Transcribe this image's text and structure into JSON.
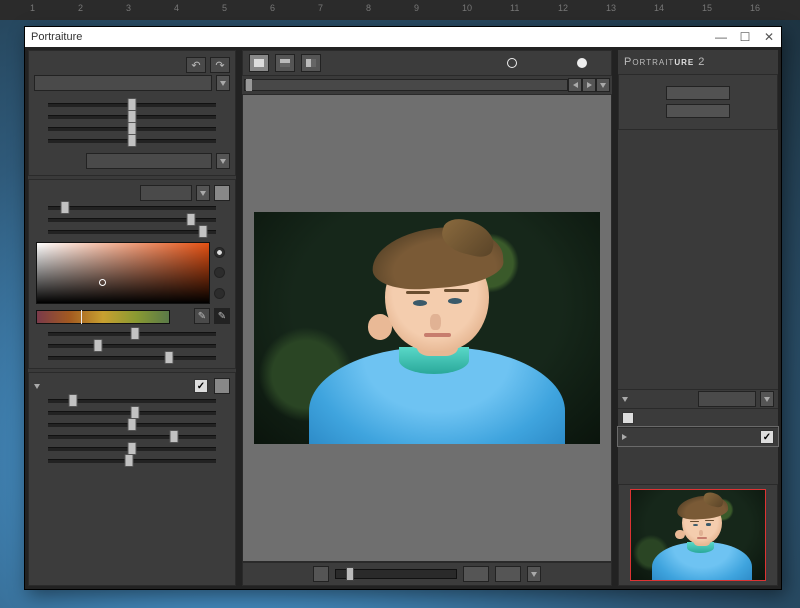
{
  "ruler_ticks": [
    "1",
    "2",
    "3",
    "4",
    "5",
    "6",
    "7",
    "8",
    "9",
    "10",
    "11",
    "12",
    "13",
    "14",
    "15",
    "16"
  ],
  "window": {
    "title": "Portraiture",
    "min": "—",
    "max": "☐",
    "close": "✕"
  },
  "left": {
    "history": {
      "undo": "↶",
      "redo": "↷"
    },
    "preset_sliders": [
      50,
      50,
      50,
      50
    ],
    "preset_bottom_slider": 50,
    "skin": {
      "sliders": [
        10,
        85,
        92
      ],
      "radio_selected": 0,
      "hue_indicator": 33,
      "eyedropper_a": "✎",
      "eyedropper_b": "✎"
    },
    "enhance": {
      "checked": true,
      "sliders": [
        15,
        52,
        50,
        75,
        50,
        48
      ]
    }
  },
  "center": {
    "views": [
      "single",
      "split-h",
      "split-v"
    ],
    "dot_a": "○",
    "dot_b": "●",
    "zoom_box_a": "",
    "zoom_box_b": ""
  },
  "right": {
    "title_a": "Portrait",
    "title_b": "ure",
    "title_num": " 2",
    "check_on": "✓"
  }
}
